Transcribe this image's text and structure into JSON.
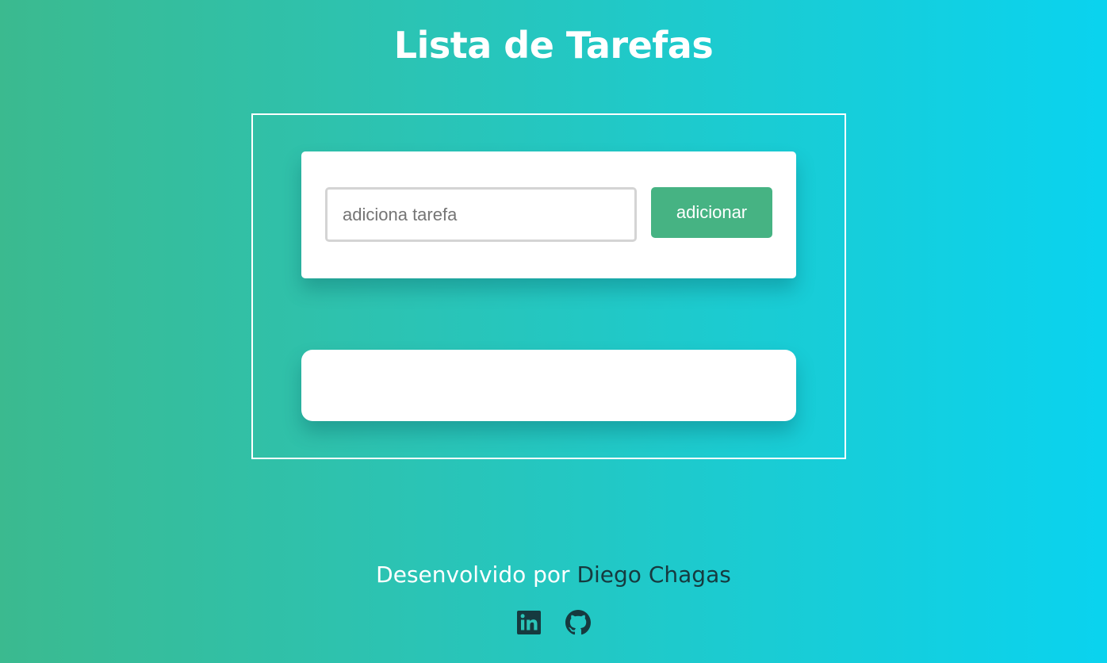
{
  "header": {
    "title": "Lista de Tarefas"
  },
  "task_form": {
    "input_placeholder": "adiciona tarefa",
    "input_value": "",
    "add_button_label": "adicionar"
  },
  "task_list": {
    "items": []
  },
  "footer": {
    "prefix": "Desenvolvido por ",
    "author": "Diego Chagas",
    "socials": [
      {
        "name": "linkedin",
        "icon": "linkedin-icon"
      },
      {
        "name": "github",
        "icon": "github-icon"
      }
    ]
  },
  "colors": {
    "gradient_start": "#3bba8f",
    "gradient_end": "#0ad3ef",
    "button": "#46b383",
    "icon": "#163a3f"
  }
}
